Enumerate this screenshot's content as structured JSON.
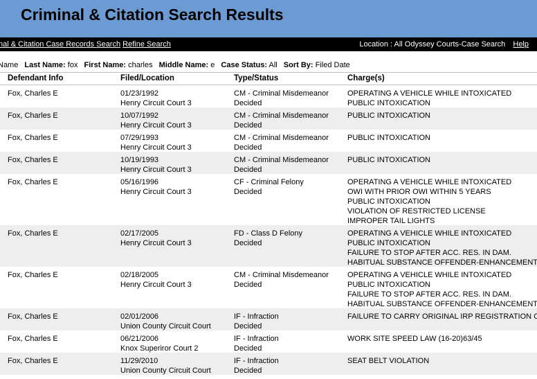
{
  "header": {
    "title": "Criminal & Citation Search Results"
  },
  "nav": {
    "link1": "nal & Citation Case Records Search",
    "link2": "Refine Search",
    "location": "Location : All Odyssey Courts-Case Search",
    "help": "Help"
  },
  "criteria": {
    "lead": "Name",
    "last_label": "Last Name:",
    "last_value": "fox",
    "first_label": "First Name:",
    "first_value": "charles",
    "middle_label": "Middle Name:",
    "middle_value": "e",
    "status_label": "Case Status:",
    "status_value": "All",
    "sort_label": "Sort By:",
    "sort_value": "Filed Date"
  },
  "columns": [
    "Defendant Info",
    "Filed/Location",
    "Type/Status",
    "Charge(s)"
  ],
  "rows": [
    {
      "defendant": "Fox, Charles E",
      "filed": "01/23/1992",
      "location": "Henry Circuit Court 3",
      "type": "CM - Criminal Misdemeanor",
      "status": "Decided",
      "charges": [
        "OPERATING A VEHICLE WHILE INTOXICATED",
        "PUBLIC INTOXICATION"
      ]
    },
    {
      "defendant": "Fox, Charles E",
      "filed": "10/07/1992",
      "location": "Henry Circuit Court 3",
      "type": "CM - Criminal Misdemeanor",
      "status": "Decided",
      "charges": [
        "PUBLIC INTOXICATION"
      ]
    },
    {
      "defendant": "Fox, Charles E",
      "filed": "07/29/1993",
      "location": "Henry Circuit Court 3",
      "type": "CM - Criminal Misdemeanor",
      "status": "Decided",
      "charges": [
        "PUBLIC INTOXICATION"
      ]
    },
    {
      "defendant": "Fox, Charles E",
      "filed": "10/19/1993",
      "location": "Henry Circuit Court 3",
      "type": "CM - Criminal Misdemeanor",
      "status": "Decided",
      "charges": [
        "PUBLIC INTOXICATION"
      ]
    },
    {
      "defendant": "Fox, Charles E",
      "filed": "05/16/1996",
      "location": "Henry Circuit Court 3",
      "type": "CF - Criminal Felony",
      "status": "Decided",
      "charges": [
        "OPERATING A VEHICLE WHILE INTOXICATED",
        "OWI WITH PRIOR OWI WITHIN 5 YEARS",
        "PUBLIC INTOXICATION",
        "VIOLATION OF RESTRICTED LICENSE",
        "IMPROPER TAIL LIGHTS"
      ]
    },
    {
      "defendant": "Fox, Charles E",
      "filed": "02/17/2005",
      "location": "Henry Circuit Court 3",
      "type": "FD - Class D Felony",
      "status": "Decided",
      "charges": [
        "OPERATING A VEHICLE WHILE INTOXICATED",
        "PUBLIC INTOXICATION",
        "FAILURE TO STOP AFTER ACC. RES. IN DAM.",
        "HABITUAL SUBSTANCE OFFENDER-ENHANCEMENT"
      ]
    },
    {
      "defendant": "Fox, Charles E",
      "filed": "02/18/2005",
      "location": "Henry Circuit Court 3",
      "type": "CM - Criminal Misdemeanor",
      "status": "Decided",
      "charges": [
        "OPERATING A VEHICLE WHILE INTOXICATED",
        "PUBLIC INTOXICATION",
        "FAILURE TO STOP AFTER ACC. RES. IN DAM.",
        "HABITUAL SUBSTANCE OFFENDER-ENHANCEMENT"
      ]
    },
    {
      "defendant": "Fox, Charles E",
      "filed": "02/01/2006",
      "location": "Union County Circuit Court",
      "type": "IF - Infraction",
      "status": "Decided",
      "charges": [
        "FAILURE TO CARRY ORIGINAL IRP REGISTRATION CAR"
      ]
    },
    {
      "defendant": "Fox, Charles E",
      "filed": "06/21/2006",
      "location": "Knox Superiror Court 2",
      "type": "IF - Infraction",
      "status": "Decided",
      "charges": [
        "WORK SITE SPEED LAW (16-20)63/45"
      ]
    },
    {
      "defendant": "Fox, Charles E",
      "filed": "11/29/2010",
      "location": "Union County Circuit Court",
      "type": "IF - Infraction",
      "status": "Decided",
      "charges": [
        "SEAT BELT VIOLATION"
      ]
    }
  ]
}
